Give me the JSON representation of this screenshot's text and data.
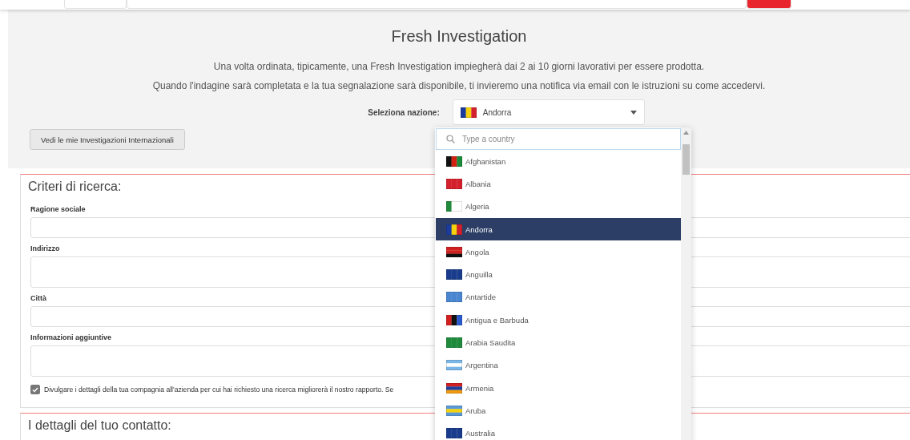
{
  "page_title": "Fresh Investigation",
  "intro": [
    "Una volta ordinata, tipicamente, una Fresh Investigation impiegherà dai 2 ai 10 giorni lavorativi per essere prodotta.",
    "Quando l'indagine sarà completata e la tua segnalazione sarà disponibile, ti invieremo una notifica via email con le istruzioni su come accedervi."
  ],
  "country_select": {
    "label": "Seleziona nazione:",
    "value": "Andorra",
    "expanded": true,
    "search_placeholder": "Type a country",
    "options": [
      {
        "name": "Afghanistan",
        "selected": false
      },
      {
        "name": "Albania",
        "selected": false
      },
      {
        "name": "Algeria",
        "selected": false
      },
      {
        "name": "Andorra",
        "selected": true
      },
      {
        "name": "Angola",
        "selected": false
      },
      {
        "name": "Anguilla",
        "selected": false
      },
      {
        "name": "Antartide",
        "selected": false
      },
      {
        "name": "Antigua e Barbuda",
        "selected": false
      },
      {
        "name": "Arabia Saudita",
        "selected": false
      },
      {
        "name": "Argentina",
        "selected": false
      },
      {
        "name": "Armenia",
        "selected": false
      },
      {
        "name": "Aruba",
        "selected": false
      },
      {
        "name": "Australia",
        "selected": false
      }
    ]
  },
  "my_investigations_button": "Vedi le mie Investigazioni Internazionali",
  "search_criteria": {
    "title": "Criteri di ricerca:",
    "fields": [
      {
        "label": "Ragione sociale",
        "kind": "short"
      },
      {
        "label": "Indirizzo",
        "kind": "tall"
      },
      {
        "label": "Città",
        "kind": "short"
      },
      {
        "label": "Informazioni aggiuntive",
        "kind": "tall"
      }
    ],
    "disclose": {
      "label": "Divulgare i dettagli della tua compagnia all'azienda per cui hai richiesto una ricerca migliorerà il nostro rapporto. Se",
      "checked": true
    }
  },
  "contact_section": {
    "title": "I dettagli del tuo contatto:"
  }
}
